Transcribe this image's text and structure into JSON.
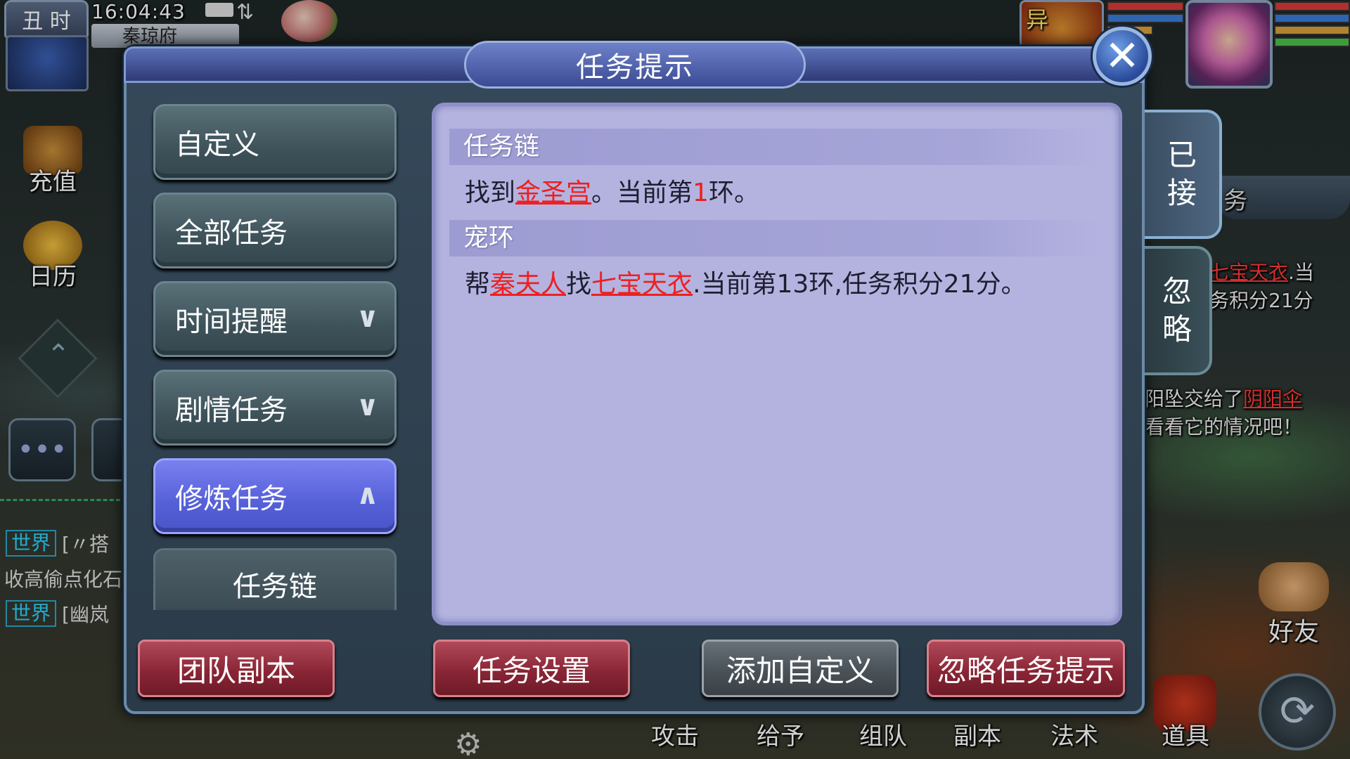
{
  "hud": {
    "hour_badge": "丑 时",
    "clock": "16:04:43",
    "location": "秦琼府",
    "pet_badge": "异",
    "recharge_label": "充值",
    "calendar_label": "日历",
    "friend_label": "好友"
  },
  "chat": {
    "lines": [
      {
        "tag": "世界",
        "msg": "[〃搭"
      },
      {
        "tag": "",
        "msg": "收高偷点化石"
      },
      {
        "tag": "世界",
        "msg": "[幽岚"
      }
    ]
  },
  "right_side": {
    "banner_text": "务",
    "task_line1_red": "七宝天衣",
    "task_line1_rest": ".当",
    "task_line2": "务积分21分",
    "notice_line1_prefix": "阳坠交给了",
    "notice_line1_red": "阴阳伞",
    "notice_line2": "看看它的情况吧！"
  },
  "bottom_bar": {
    "items": [
      "攻击",
      "给予",
      "组队",
      "副本",
      "法术",
      "道具"
    ]
  },
  "dialog": {
    "title": "任务提示",
    "menu": [
      {
        "label": "自定义",
        "chevron": ""
      },
      {
        "label": "全部任务",
        "chevron": ""
      },
      {
        "label": "时间提醒",
        "chevron": "∨"
      },
      {
        "label": "剧情任务",
        "chevron": "∨"
      },
      {
        "label": "修炼任务",
        "chevron": "∧"
      }
    ],
    "submenu_item": "任务链",
    "tasks": [
      {
        "header": "任务链",
        "parts": [
          {
            "t": "找到",
            "s": ""
          },
          {
            "t": "金圣宫",
            "s": "hl"
          },
          {
            "t": "。当前第",
            "s": ""
          },
          {
            "t": "1",
            "s": "num"
          },
          {
            "t": "环。",
            "s": ""
          }
        ]
      },
      {
        "header": "宠环",
        "parts": [
          {
            "t": "帮",
            "s": ""
          },
          {
            "t": "秦夫人",
            "s": "hl"
          },
          {
            "t": "找",
            "s": ""
          },
          {
            "t": "七宝天衣",
            "s": "hl"
          },
          {
            "t": ".当前第13环,任务积分21分。",
            "s": ""
          }
        ]
      }
    ],
    "tabs": {
      "accepted": [
        "已",
        "接"
      ],
      "ignored": [
        "忽",
        "略"
      ]
    },
    "buttons": {
      "team_dungeon": "团队副本",
      "task_settings": "任务设置",
      "add_custom": "添加自定义",
      "ignore_hint": "忽略任务提示"
    }
  }
}
